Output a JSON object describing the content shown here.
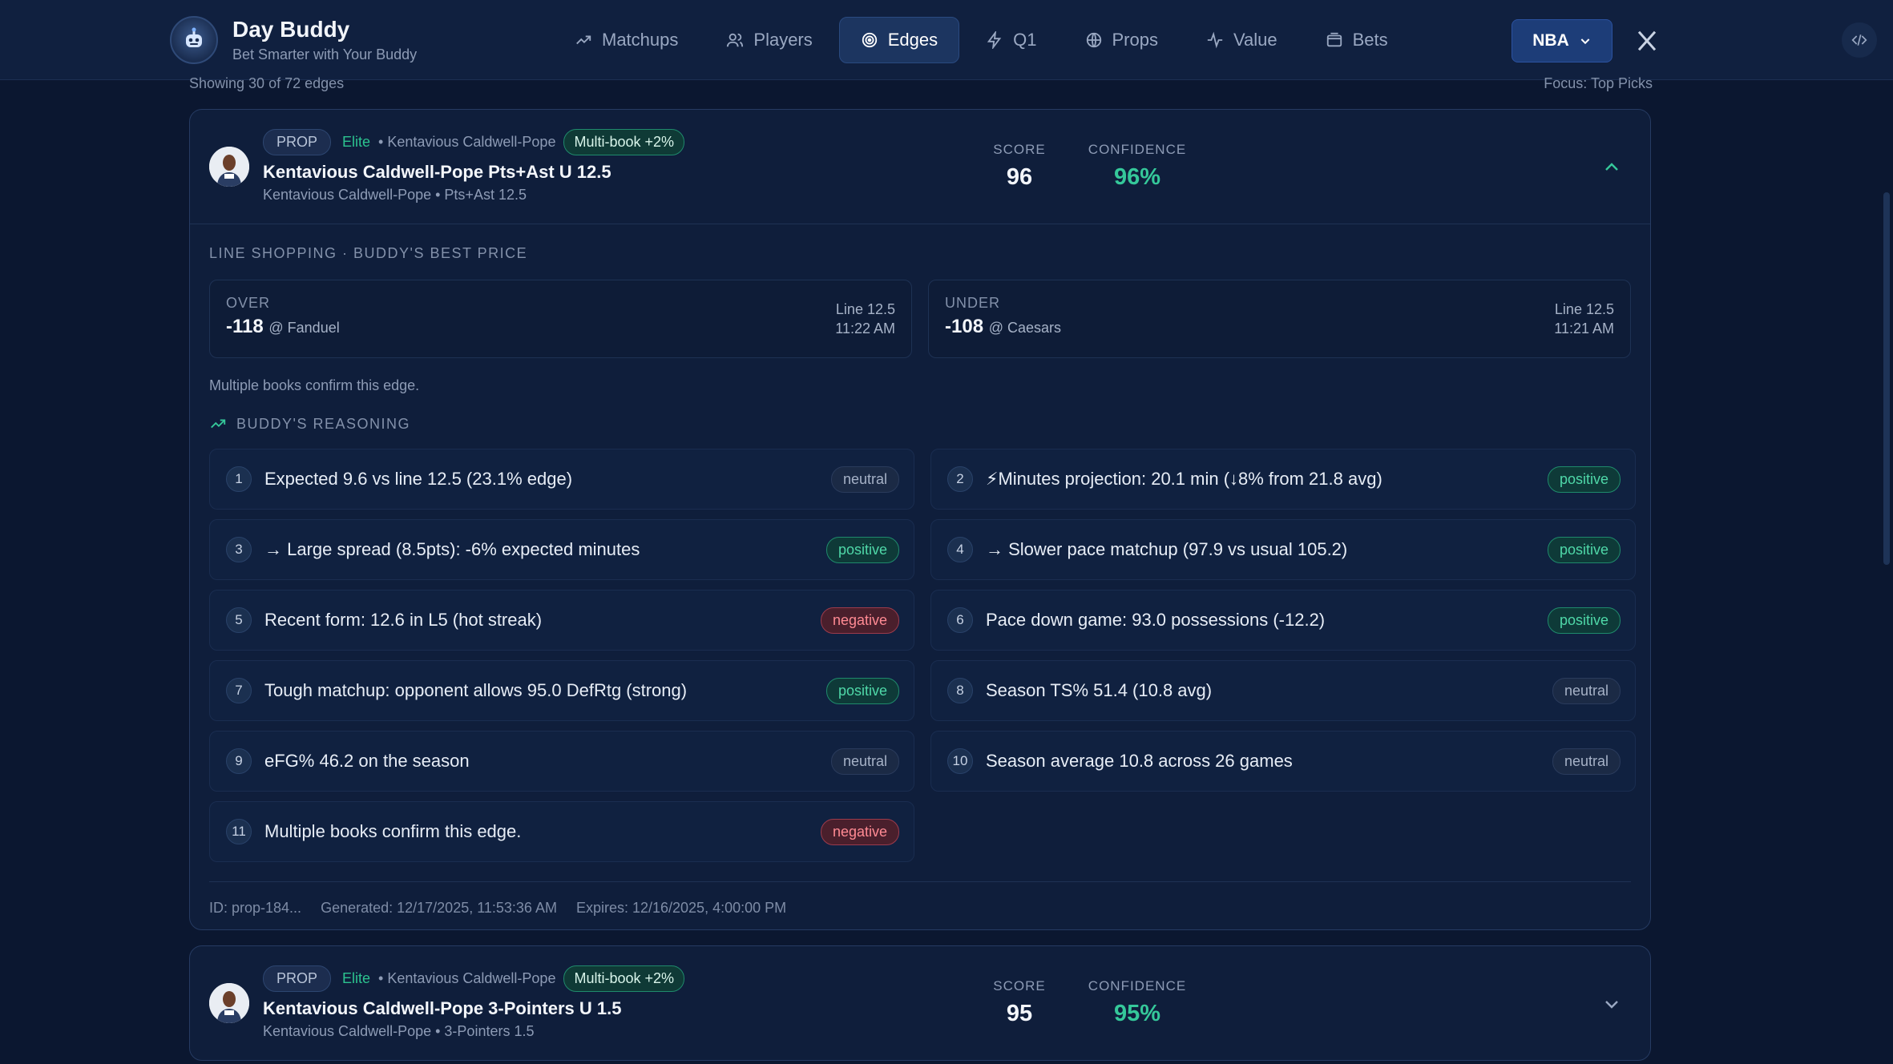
{
  "brand": {
    "title": "Day Buddy",
    "subtitle": "Bet Smarter with Your Buddy"
  },
  "nav": {
    "items": [
      {
        "label": "Matchups",
        "icon": "trend-up-icon"
      },
      {
        "label": "Players",
        "icon": "users-icon"
      },
      {
        "label": "Edges",
        "icon": "target-icon",
        "active": true
      },
      {
        "label": "Q1",
        "icon": "bolt-icon"
      },
      {
        "label": "Props",
        "icon": "basketball-icon"
      },
      {
        "label": "Value",
        "icon": "pulse-icon"
      },
      {
        "label": "Bets",
        "icon": "wallet-icon"
      }
    ],
    "league": "NBA"
  },
  "meta": {
    "showing": "Showing 30 of 72 edges",
    "focus": "Focus: Top Picks"
  },
  "cards": [
    {
      "tag": "PROP",
      "tier": "Elite",
      "player_tag": "• Kentavious Caldwell-Pope",
      "multi": "Multi-book +2%",
      "title": "Kentavious Caldwell-Pope Pts+Ast U 12.5",
      "subtitle": "Kentavious Caldwell-Pope • Pts+Ast 12.5",
      "score_label": "SCORE",
      "score": "96",
      "confidence_label": "CONFIDENCE",
      "confidence": "96%",
      "line_shopping_heading": "LINE SHOPPING · BUDDY'S BEST PRICE",
      "over": {
        "side": "OVER",
        "odds": "-118",
        "book": "@ Fanduel",
        "line": "Line 12.5",
        "time": "11:22 AM"
      },
      "under": {
        "side": "UNDER",
        "odds": "-108",
        "book": "@ Caesars",
        "line": "Line 12.5",
        "time": "11:21 AM"
      },
      "confirm_note": "Multiple books confirm this edge.",
      "reasoning_heading": "BUDDY'S REASONING",
      "reasons": [
        {
          "n": "1",
          "text": "Expected 9.6 vs line 12.5 (23.1% edge)",
          "sentiment": "neutral"
        },
        {
          "n": "2",
          "text": "⚡Minutes projection: 20.1 min (↓8% from 21.8 avg)",
          "sentiment": "positive"
        },
        {
          "n": "3",
          "text": "→ Large spread (8.5pts): -6% expected minutes",
          "sentiment": "positive"
        },
        {
          "n": "4",
          "text": "→ Slower pace matchup (97.9 vs usual 105.2)",
          "sentiment": "positive"
        },
        {
          "n": "5",
          "text": "Recent form: 12.6 in L5 (hot streak)",
          "sentiment": "negative"
        },
        {
          "n": "6",
          "text": "Pace down game: 93.0 possessions (-12.2)",
          "sentiment": "positive"
        },
        {
          "n": "7",
          "text": "Tough matchup: opponent allows 95.0 DefRtg (strong)",
          "sentiment": "positive"
        },
        {
          "n": "8",
          "text": "Season TS% 51.4 (10.8 avg)",
          "sentiment": "neutral"
        },
        {
          "n": "9",
          "text": "eFG% 46.2 on the season",
          "sentiment": "neutral"
        },
        {
          "n": "10",
          "text": "Season average 10.8 across 26 games",
          "sentiment": "neutral"
        },
        {
          "n": "11",
          "text": "Multiple books confirm this edge.",
          "sentiment": "negative"
        }
      ],
      "footer": {
        "id": "ID: prop-184...",
        "generated": "Generated: 12/17/2025, 11:53:36 AM",
        "expires": "Expires: 12/16/2025, 4:00:00 PM"
      }
    },
    {
      "tag": "PROP",
      "tier": "Elite",
      "player_tag": "• Kentavious Caldwell-Pope",
      "multi": "Multi-book +2%",
      "title": "Kentavious Caldwell-Pope 3-Pointers U 1.5",
      "subtitle": "Kentavious Caldwell-Pope • 3-Pointers 1.5",
      "score_label": "SCORE",
      "score": "95",
      "confidence_label": "CONFIDENCE",
      "confidence": "95%"
    }
  ],
  "colors": {
    "positive": "#4fd8a8",
    "negative": "#ff8a93",
    "neutral": "#a6b2c7",
    "accent": "#35c89a"
  }
}
